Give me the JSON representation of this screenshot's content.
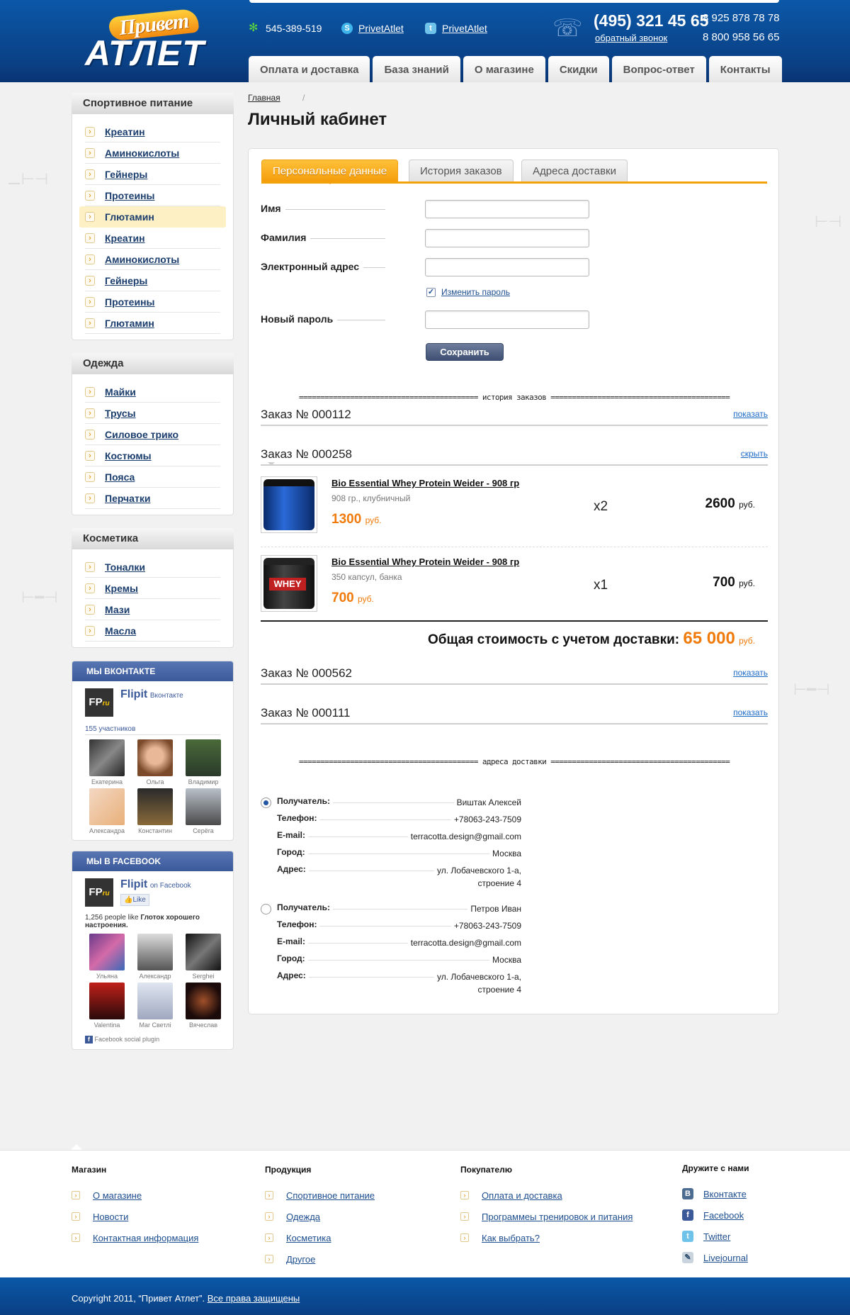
{
  "header": {
    "logo_line1": "Привет",
    "logo_line2": "АТЛЕТ",
    "icq": "545-389-519",
    "skype": "PrivetAtlet",
    "twitter": "PrivetAtlet",
    "main_phone": "(495) 321 45 65",
    "callback": "обратный звонок",
    "phone2": "8 925 878 78 78",
    "phone3": "8 800 958 56 65",
    "nav": [
      "Оплата и доставка",
      "База знаний",
      "О магазине",
      "Скидки",
      "Вопрос-ответ",
      "Контакты"
    ]
  },
  "sidebar": {
    "categories": [
      {
        "title": "Спортивное питание",
        "items": [
          "Креатин",
          "Аминокислоты",
          "Гейнеры",
          "Протеины",
          "Глютамин",
          "Креатин",
          "Аминокислоты",
          "Гейнеры",
          "Протеины",
          "Глютамин"
        ],
        "active_index": 4
      },
      {
        "title": "Одежда",
        "items": [
          "Майки",
          "Трусы",
          "Силовое трико",
          "Костюмы",
          "Пояса",
          "Перчатки"
        ]
      },
      {
        "title": "Косметика",
        "items": [
          "Тоналки",
          "Кремы",
          "Мази",
          "Масла"
        ]
      }
    ],
    "vk": {
      "title": "МЫ ВКОНТАКТЕ",
      "brand": "Flipit",
      "brand_sub": "Вконтакте",
      "logo_text": "FP",
      "logo_sub": "ru",
      "count": "155 участников",
      "members": [
        "Екатерина",
        "Ольга",
        "Владимир",
        "Александра",
        "Константин",
        "Серёга"
      ]
    },
    "fb": {
      "title": "МЫ В FACEBOOK",
      "brand": "Flipit",
      "brand_sub": "on Facebook",
      "logo_text": "FP",
      "logo_sub": "ru",
      "like": "Like",
      "likes_text": "1,256 people like",
      "likes_page": "Глоток хорошего настроения.",
      "members": [
        "Ульяна",
        "Александр",
        "Serghei",
        "Valentina",
        "Mar Светлі",
        "Вячеслав"
      ],
      "plugin": "Facebook social plugin"
    }
  },
  "content": {
    "breadcrumb": "Главная",
    "breadcrumb_sep": "/",
    "title": "Личный кабинет",
    "tabs": [
      "Персональные данные",
      "История заказов",
      "Адреса доставки"
    ],
    "form": {
      "first_name": "Имя",
      "last_name": "Фамилия",
      "email": "Электронный адрес",
      "change_password": "Изменить пароль",
      "new_password": "Новый пароль",
      "save": "Сохранить"
    },
    "history_divider": "========================================== история заказов ==========================================",
    "orders": [
      {
        "title": "Заказ № 000112",
        "action": "показать"
      },
      {
        "title": "Заказ № 000258",
        "action": "скрыть"
      },
      {
        "title": "Заказ № 000562",
        "action": "показать"
      },
      {
        "title": "Заказ № 000111",
        "action": "показать"
      }
    ],
    "items": [
      {
        "name": "Bio Essential Whey Protein Weider - 908 гр",
        "desc": "908 гр., клубничный",
        "price": "1300",
        "currency": "руб.",
        "qty": "x2",
        "total": "2600"
      },
      {
        "name": "Bio Essential Whey Protein Weider - 908 гр",
        "desc": "350 капсул, банка",
        "price": "700",
        "currency": "руб.",
        "qty": "x1",
        "total": "700"
      }
    ],
    "grand_total_label": "Общая стоимость с учетом доставки:",
    "grand_total_value": "65 000",
    "grand_total_currency": "руб.",
    "address_divider": "========================================== адреса доставки ==========================================",
    "addresses": [
      {
        "selected": true,
        "recipient": "Виштак Алексей",
        "phone": "+78063-243-7509",
        "email": "terracotta.design@gmail.com",
        "city": "Москва",
        "address": "ул. Лобачевского 1-а,",
        "address2": "строение 4"
      },
      {
        "selected": false,
        "recipient": "Петров Иван",
        "phone": "+78063-243-7509",
        "email": "terracotta.design@gmail.com",
        "city": "Москва",
        "address": "ул. Лобачевского 1-а,",
        "address2": "строение 4"
      }
    ],
    "address_labels": {
      "recipient": "Получатель:",
      "phone": "Телефон:",
      "email": "E-mail:",
      "city": "Город:",
      "address": "Адрес:"
    }
  },
  "footer": {
    "shop": {
      "title": "Магазин",
      "items": [
        "О магазине",
        "Новости",
        "Контактная информация"
      ]
    },
    "products": {
      "title": "Продукция",
      "items": [
        "Спортивное питание",
        "Одежда",
        "Косметика",
        "Другое"
      ]
    },
    "buyer": {
      "title": "Покупателю",
      "items": [
        "Оплата и доставка",
        "Программеы тренировок и питания",
        "Как выбрать?"
      ]
    },
    "social": {
      "title": "Дружите с нами",
      "items": [
        "Вконтакте",
        "Facebook",
        "Twitter",
        "Livejournal"
      ]
    },
    "copyright": "Copyright 2011, “Привет Атлет”.",
    "rights": "Все права защищены"
  }
}
